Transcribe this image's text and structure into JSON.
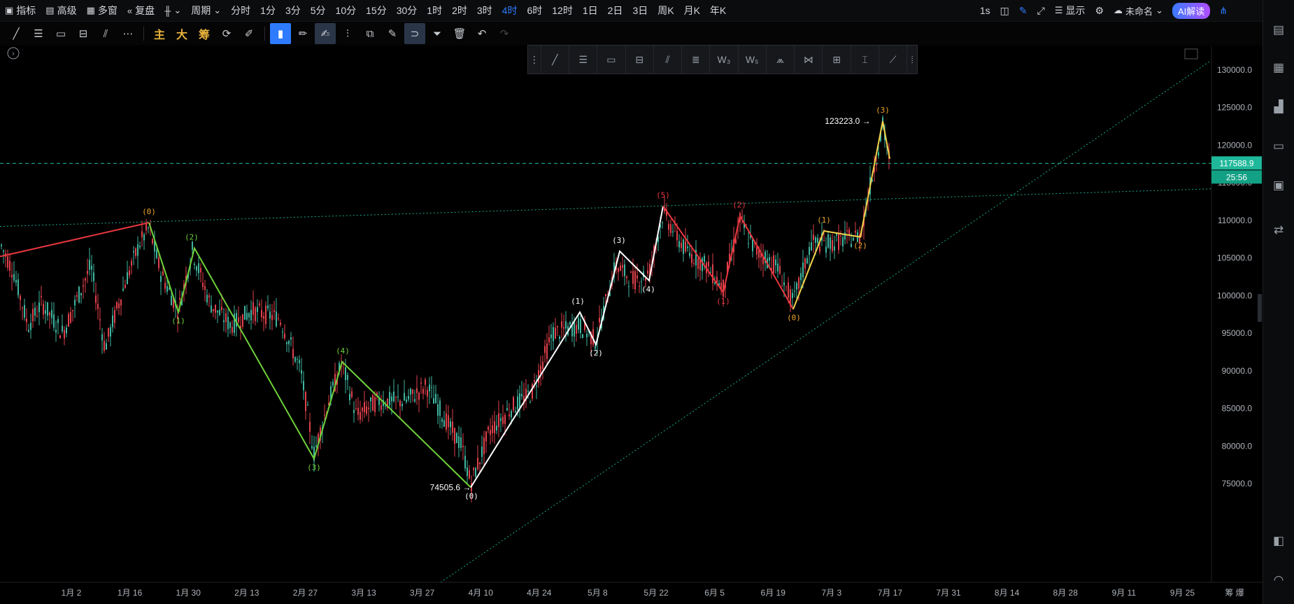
{
  "toolbar": {
    "indicators": "指标",
    "advanced": "高级",
    "multiwin": "多窗",
    "replay": "复盘",
    "period": "周期",
    "periods": [
      "分时",
      "1分",
      "3分",
      "5分",
      "10分",
      "15分",
      "30分",
      "1时",
      "2时",
      "3时",
      "4时",
      "6时",
      "12时",
      "1日",
      "2日",
      "3日",
      "周K",
      "月K",
      "年K"
    ],
    "active_period": "4时",
    "interval": "1s",
    "display": "显示",
    "unnamed": "未命名",
    "ai": "AI解读"
  },
  "drawing_tools": {
    "main_label": "主",
    "big_label": "大",
    "chip_label": "筹"
  },
  "price_axis": {
    "ticks": [
      "130000.0",
      "125000.0",
      "120000.0",
      "115000.0",
      "110000.0",
      "105000.0",
      "100000.0",
      "95000.0",
      "90000.0",
      "85000.0",
      "80000.0",
      "75000.0"
    ],
    "current_price": "117588.9",
    "countdown": "25:56",
    "price_color": "#1fb89a"
  },
  "time_axis": {
    "ticks": [
      "1月 2",
      "1月 16",
      "1月 30",
      "2月 13",
      "2月 27",
      "3月 13",
      "3月 27",
      "4月 10",
      "4月 24",
      "5月 8",
      "5月 22",
      "6月 5",
      "6月 19",
      "7月 3",
      "7月 17",
      "7月 31",
      "8月 14",
      "8月 28",
      "9月 11",
      "9月 25"
    ],
    "right_label": "筹 爆"
  },
  "annotations": {
    "high": "123223.0",
    "low": "74505.6"
  },
  "colors": {
    "red": "#e8373f",
    "green": "#6fd13a",
    "white": "#ffffff",
    "yellow": "#f4d34a",
    "orange": "#f0a52c",
    "trend": "#17a98d"
  },
  "chart_data": {
    "type": "candlestick-with-elliott-waves",
    "timeframe": "4时",
    "last_price": 117588.9,
    "high": 123223.0,
    "low": 74505.6,
    "price_range": [
      72000,
      131000
    ],
    "waves": [
      {
        "color": "red",
        "labels": []
      },
      {
        "color": "green",
        "labels": [
          "(0)",
          "(1)",
          "(2)",
          "(3)",
          "(4)"
        ]
      },
      {
        "color": "white",
        "labels": [
          "(0)",
          "(1)",
          "(2)",
          "(3)",
          "(4)",
          "(5)"
        ]
      },
      {
        "color": "red",
        "labels": [
          "(1)",
          "(2)"
        ]
      },
      {
        "color": "yellow",
        "labels": [
          "(0)",
          "(1)",
          "(2)",
          "(3)"
        ]
      }
    ]
  }
}
